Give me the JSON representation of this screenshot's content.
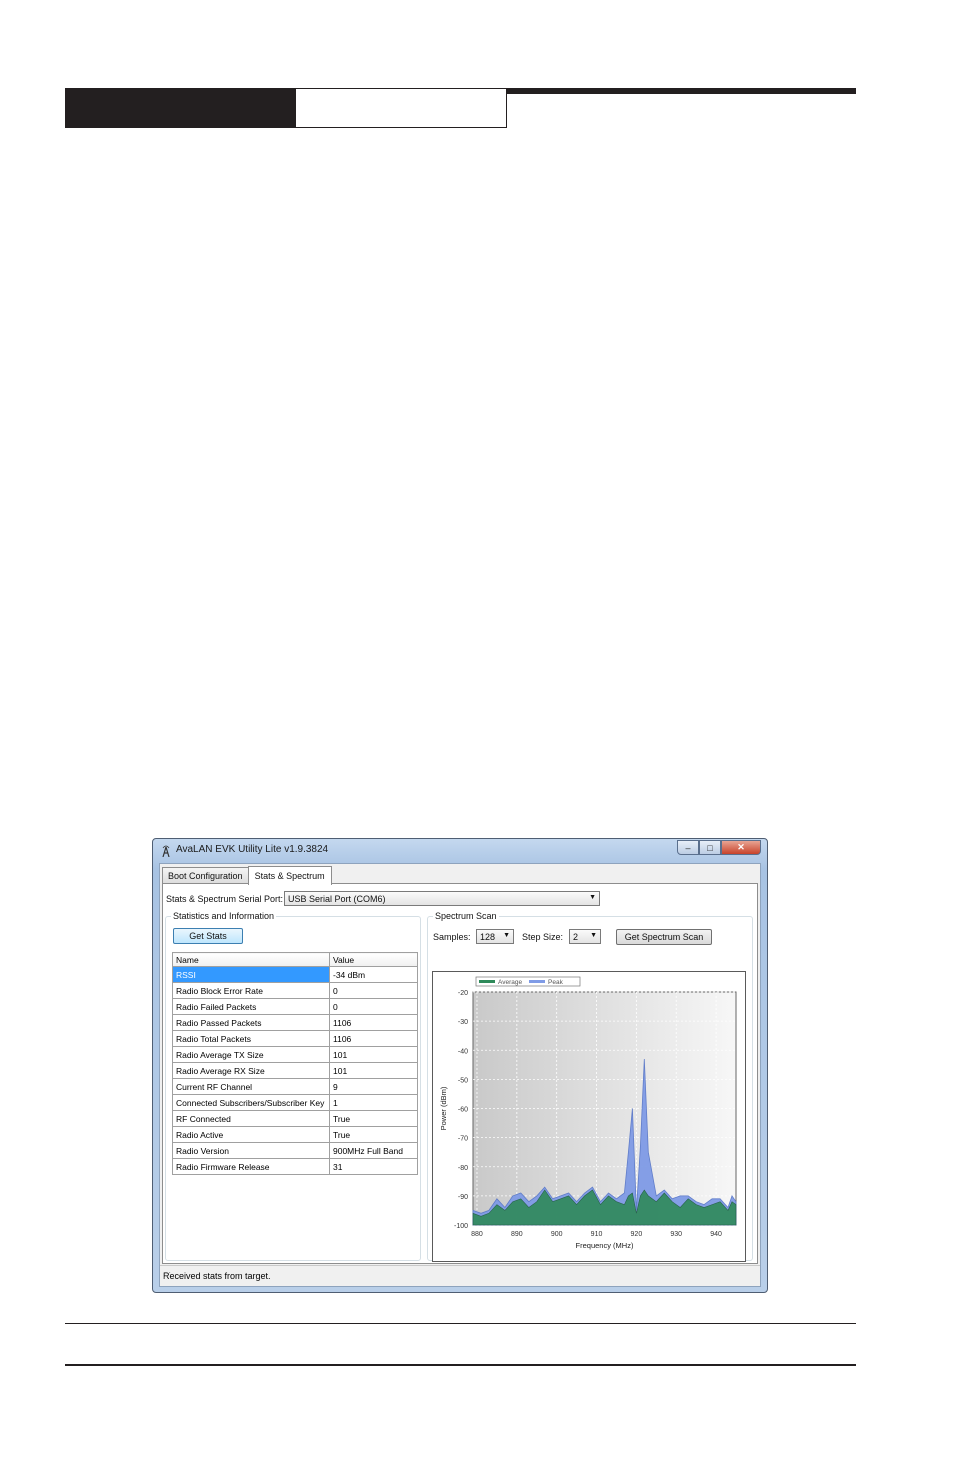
{
  "window": {
    "title": "AvaLAN EVK Utility Lite v1.9.3824",
    "controls": {
      "minimize": "–",
      "maximize": "□",
      "close": "✕"
    }
  },
  "tabs": [
    {
      "label": "Boot Configuration",
      "active": false
    },
    {
      "label": "Stats & Spectrum",
      "active": true
    }
  ],
  "serial_port": {
    "label": "Stats & Spectrum Serial Port:",
    "value": "USB Serial Port (COM6)"
  },
  "stats": {
    "group_title": "Statistics and Information",
    "button": "Get Stats",
    "columns": [
      "Name",
      "Value"
    ],
    "rows": [
      {
        "name": "RSSI",
        "value": "-34 dBm",
        "selected": true
      },
      {
        "name": "Radio Block Error Rate",
        "value": "0"
      },
      {
        "name": "Radio Failed Packets",
        "value": "0"
      },
      {
        "name": "Radio Passed Packets",
        "value": "1106"
      },
      {
        "name": "Radio Total Packets",
        "value": "1106"
      },
      {
        "name": "Radio Average TX Size",
        "value": "101"
      },
      {
        "name": "Radio Average RX Size",
        "value": "101"
      },
      {
        "name": "Current RF Channel",
        "value": "9"
      },
      {
        "name": "Connected Subscribers/Subscriber Key",
        "value": "1"
      },
      {
        "name": "RF Connected",
        "value": "True"
      },
      {
        "name": "Radio Active",
        "value": "True"
      },
      {
        "name": "Radio Version",
        "value": "900MHz Full Band"
      },
      {
        "name": "Radio Firmware Release",
        "value": "31"
      }
    ]
  },
  "spectrum": {
    "group_title": "Spectrum Scan",
    "samples_label": "Samples:",
    "samples_value": "128",
    "step_label": "Step Size:",
    "step_value": "2",
    "button": "Get Spectrum Scan"
  },
  "status_text": "Received stats from target.",
  "chart_data": {
    "type": "area",
    "xlabel": "Frequency (MHz)",
    "ylabel": "Power (dBm)",
    "xlim": [
      879,
      945
    ],
    "ylim": [
      -100,
      -20
    ],
    "xticks": [
      880,
      890,
      900,
      910,
      920,
      930,
      940
    ],
    "yticks": [
      -20,
      -30,
      -40,
      -50,
      -60,
      -70,
      -80,
      -90,
      -100
    ],
    "grid": true,
    "legend": "top-left",
    "x": [
      879,
      881,
      883,
      885,
      887,
      889,
      891,
      893,
      895,
      897,
      899,
      901,
      903,
      905,
      907,
      909,
      911,
      913,
      915,
      917,
      918,
      919,
      920,
      921,
      922,
      923,
      925,
      927,
      929,
      931,
      933,
      935,
      937,
      939,
      941,
      943,
      944,
      945
    ],
    "series": [
      {
        "name": "Average",
        "color": "#2f8a5a",
        "values": [
          -96,
          -97,
          -96,
          -93,
          -95,
          -92,
          -91,
          -94,
          -92,
          -88,
          -92,
          -91,
          -90,
          -93,
          -90,
          -88,
          -93,
          -90,
          -92,
          -93,
          -90,
          -89,
          -96,
          -90,
          -88,
          -90,
          -92,
          -89,
          -92,
          -94,
          -91,
          -93,
          -94,
          -93,
          -92,
          -95,
          -92,
          -93
        ]
      },
      {
        "name": "Peak",
        "color": "#7f9be6",
        "values": [
          -95,
          -96,
          -95,
          -91,
          -94,
          -90,
          -89,
          -92,
          -90,
          -87,
          -91,
          -90,
          -89,
          -92,
          -89,
          -87,
          -92,
          -89,
          -91,
          -89,
          -75,
          -60,
          -95,
          -73,
          -43,
          -75,
          -90,
          -88,
          -91,
          -90,
          -90,
          -92,
          -93,
          -91,
          -91,
          -94,
          -90,
          -92
        ]
      }
    ]
  }
}
